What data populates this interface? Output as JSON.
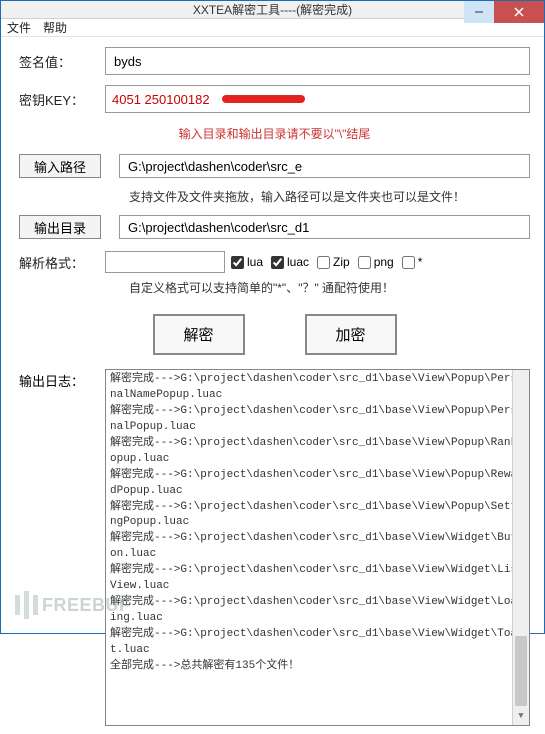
{
  "window": {
    "title": "XXTEA解密工具----(解密完成)"
  },
  "menu": {
    "file": "文件",
    "help": "帮助"
  },
  "labels": {
    "sign": "签名值：",
    "key": "密钥KEY：",
    "path": "输入路径",
    "outdir": "输出目录",
    "format": "解析格式：",
    "log": "输出日志："
  },
  "fields": {
    "sign": "byds",
    "key_visible": "4051                                        250100182",
    "path": "G:\\project\\dashen\\coder\\src_e",
    "outdir": "G:\\project\\dashen\\coder\\src_d1",
    "format_text": ""
  },
  "hints": {
    "io_warn": "输入目录和输出目录请不要以\"\\\"结尾",
    "path_hint": "支持文件及文件夹拖放，输入路径可以是文件夹也可以是文件！",
    "format_hint": "自定义格式可以支持简单的\"*\"、\"？\" 通配符使用！"
  },
  "checks": {
    "lua": {
      "label": "lua",
      "checked": true
    },
    "luac": {
      "label": "luac",
      "checked": true
    },
    "zip": {
      "label": "Zip",
      "checked": false
    },
    "png": {
      "label": "png",
      "checked": false
    },
    "star": {
      "label": "*",
      "checked": false
    }
  },
  "actions": {
    "decrypt": "解密",
    "encrypt": "加密"
  },
  "log_lines": [
    "解密完成--->G:\\project\\dashen\\coder\\src_d1\\base\\View\\Popup\\PersonalNamePopup.luac",
    "解密完成--->G:\\project\\dashen\\coder\\src_d1\\base\\View\\Popup\\PersonalPopup.luac",
    "解密完成--->G:\\project\\dashen\\coder\\src_d1\\base\\View\\Popup\\RankPopup.luac",
    "解密完成--->G:\\project\\dashen\\coder\\src_d1\\base\\View\\Popup\\RewardPopup.luac",
    "解密完成--->G:\\project\\dashen\\coder\\src_d1\\base\\View\\Popup\\SettingPopup.luac",
    "解密完成--->G:\\project\\dashen\\coder\\src_d1\\base\\View\\Widget\\Button.luac",
    "解密完成--->G:\\project\\dashen\\coder\\src_d1\\base\\View\\Widget\\ListView.luac",
    "解密完成--->G:\\project\\dashen\\coder\\src_d1\\base\\View\\Widget\\Loading.luac",
    "解密完成--->G:\\project\\dashen\\coder\\src_d1\\base\\View\\Widget\\Toast.luac",
    "全部完成--->总共解密有135个文件！"
  ],
  "watermark": "FREEBUF"
}
